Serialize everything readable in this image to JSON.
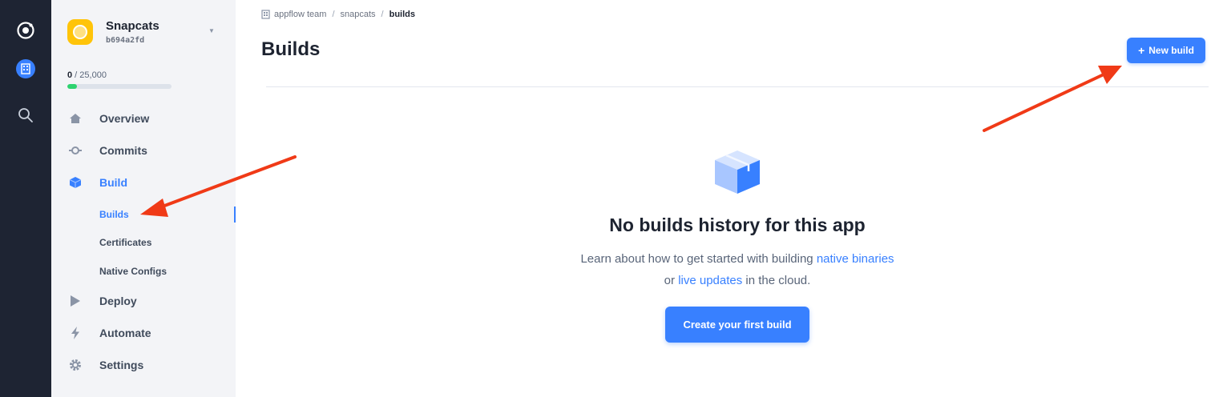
{
  "app": {
    "name": "Snapcats",
    "id": "b694a2fd",
    "usage_used": "0",
    "usage_total": " / 25,000",
    "usage_fraction": 0.09
  },
  "nav": {
    "overview": "Overview",
    "commits": "Commits",
    "build": "Build",
    "builds": "Builds",
    "certificates": "Certificates",
    "native_configs": "Native Configs",
    "deploy": "Deploy",
    "automate": "Automate",
    "settings": "Settings"
  },
  "breadcrumb": {
    "team": "appflow team",
    "sep1": "/",
    "app": "snapcats",
    "sep2": "/",
    "current": "builds"
  },
  "page": {
    "title": "Builds",
    "new_build_plus": "+",
    "new_build_label": "New build"
  },
  "empty": {
    "title": "No builds history for this app",
    "desc_1": "Learn about how to get started with building ",
    "link_native_binaries": "native binaries",
    "desc_2": " or ",
    "link_live_updates": "live updates",
    "desc_3": " in the cloud.",
    "cta": "Create your first build"
  },
  "colors": {
    "accent": "#3880ff",
    "rail": "#1e2433",
    "sidebar": "#f3f4f7",
    "annotation_arrow": "#f03a17",
    "usage_fill": "#2dd36f"
  },
  "icons": {
    "rail": [
      "ionic-logo-icon",
      "organization-icon",
      "search-icon"
    ],
    "nav": [
      "home-icon",
      "commit-icon",
      "cube-icon",
      "play-icon",
      "bolt-icon",
      "gear-icon"
    ],
    "empty_state": "box-icon"
  }
}
